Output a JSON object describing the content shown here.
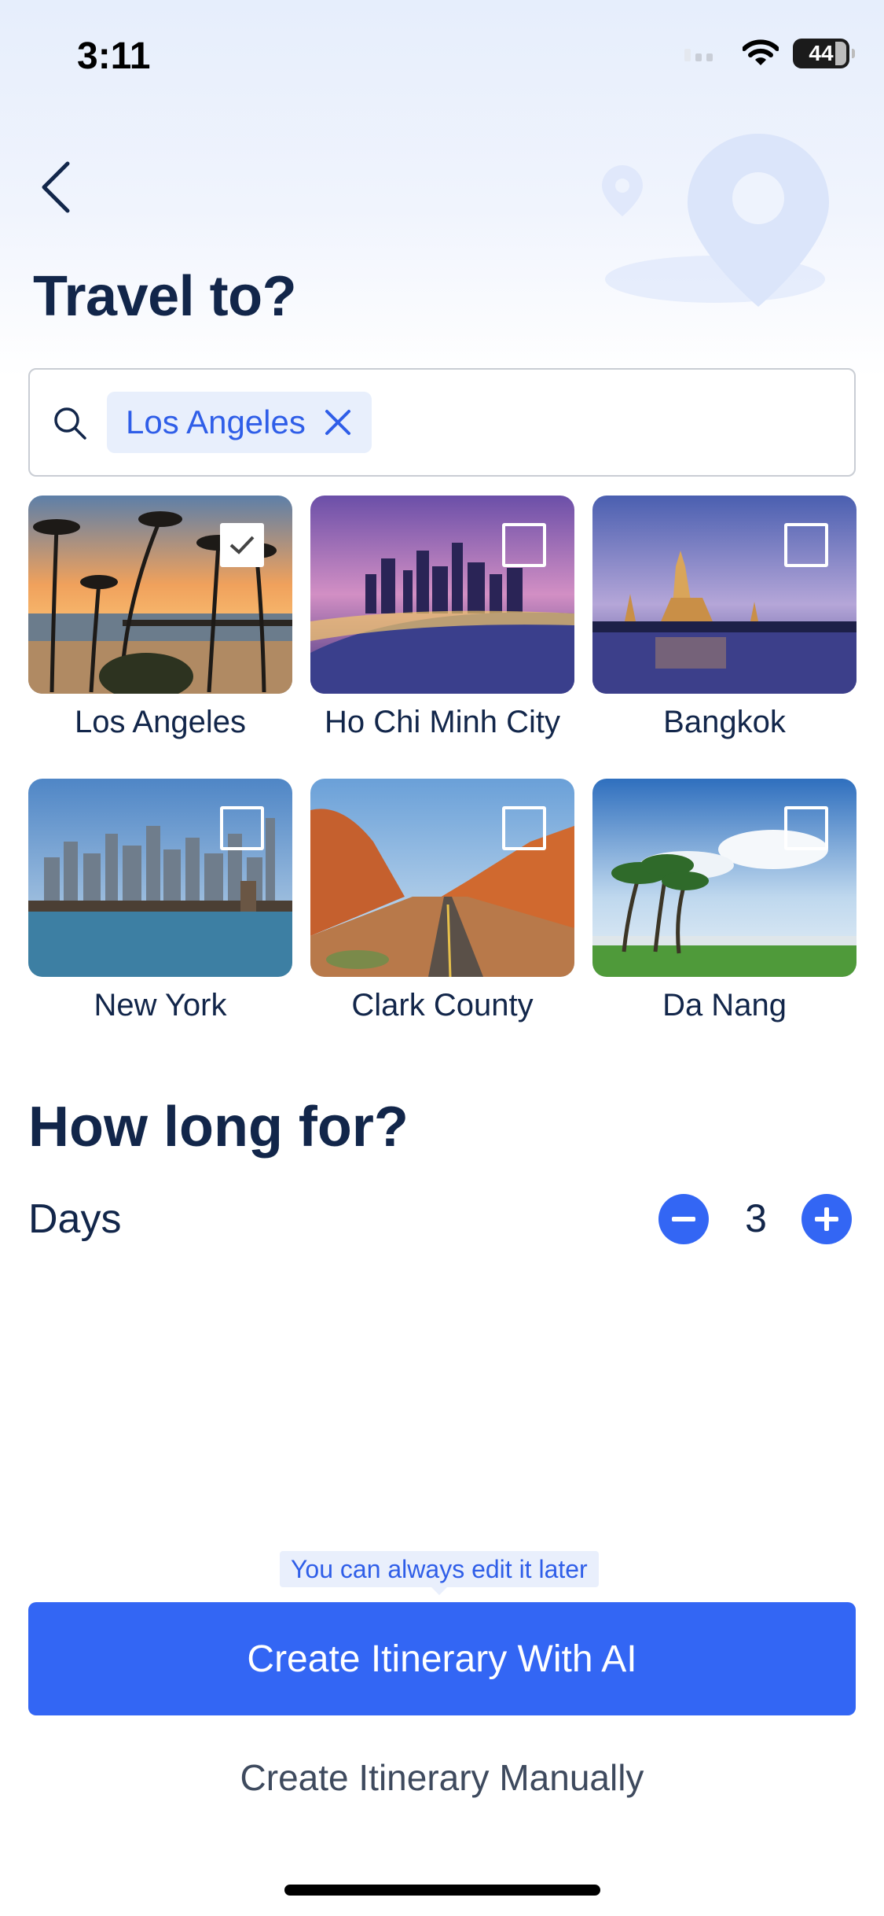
{
  "status_bar": {
    "time": "3:11",
    "battery": "44"
  },
  "header": {
    "title": "Travel to?"
  },
  "search": {
    "chip_label": "Los Angeles"
  },
  "destinations": [
    {
      "name": "Los Angeles",
      "selected": true
    },
    {
      "name": "Ho Chi Minh City",
      "selected": false
    },
    {
      "name": "Bangkok",
      "selected": false
    },
    {
      "name": "New York",
      "selected": false
    },
    {
      "name": "Clark County",
      "selected": false
    },
    {
      "name": "Da Nang",
      "selected": false
    }
  ],
  "duration": {
    "title": "How long for?",
    "label": "Days",
    "value": "3"
  },
  "footer": {
    "hint": "You can always edit it later",
    "primary_button": "Create Itinerary With AI",
    "secondary_button": "Create Itinerary Manually"
  },
  "colors": {
    "accent": "#3366f4",
    "heading": "#12264a",
    "chip_bg": "#e8effc"
  }
}
